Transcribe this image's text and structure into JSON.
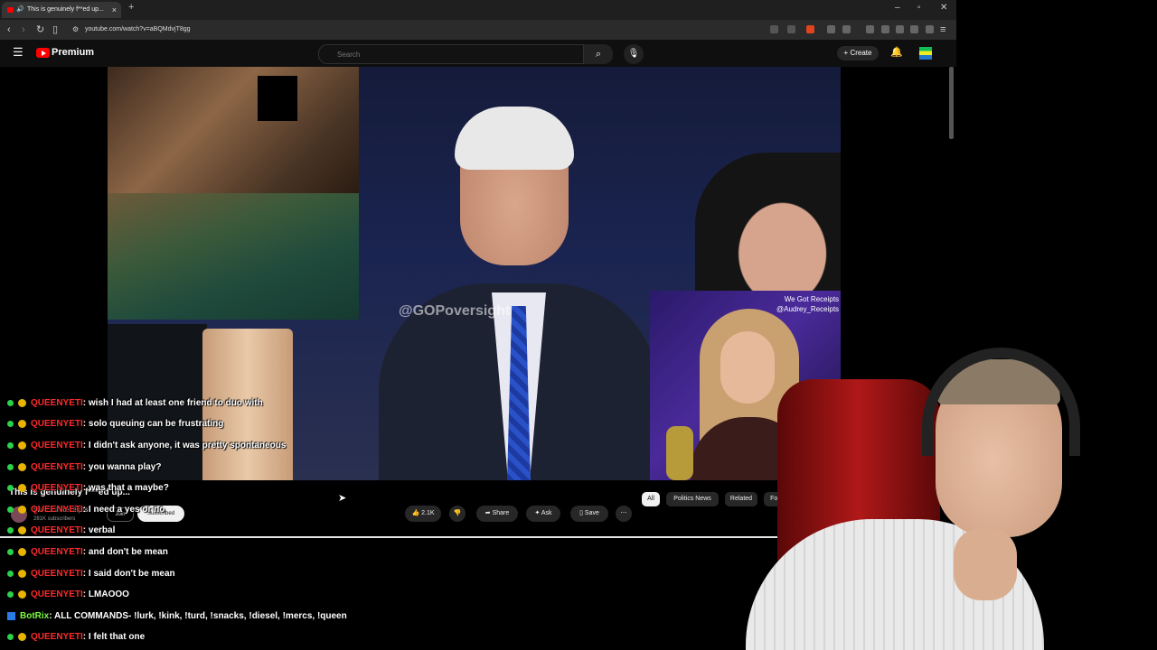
{
  "browser": {
    "tab_title": "This is genuinely f**ed up...",
    "new_tab": "+",
    "url": "youtube.com/watch?v=aBQMdvjT8gg"
  },
  "youtube": {
    "brand": "Premium",
    "search_placeholder": "Search",
    "create_label": "Create"
  },
  "video": {
    "watermark": "@GOPoversight",
    "pip_caption_line1": "We Got Receipts",
    "pip_caption_line2": "@Audrey_Receipts",
    "title": "This is genuinely f***ed up...",
    "channel_name": "We Got Receipts",
    "subscribers": "281K subscribers",
    "join_label": "Join",
    "subscribe_label": "Subscribed",
    "likes": "2.1K",
    "share_label": "Share",
    "ask_label": "Ask",
    "save_label": "Save"
  },
  "chips": [
    "All",
    "Politics News",
    "Related",
    "For you"
  ],
  "chat": [
    {
      "user": "QUEENYETI",
      "msg": ": wish I had at least one friend to duo with",
      "badge": "queen"
    },
    {
      "user": "QUEENYETI",
      "msg": ": solo queuing can be frustrating",
      "badge": "queen"
    },
    {
      "user": "QUEENYETI",
      "msg": ": I didn't ask anyone, it was pretty spontaneous",
      "badge": "queen"
    },
    {
      "user": "QUEENYETI",
      "msg": ": you wanna play?",
      "badge": "queen"
    },
    {
      "user": "QUEENYETI",
      "msg": ": was that a maybe?",
      "badge": "queen"
    },
    {
      "user": "QUEENYETI",
      "msg": ": I need a yes or no",
      "badge": "queen"
    },
    {
      "user": "QUEENYETI",
      "msg": ": verbal",
      "badge": "queen"
    },
    {
      "user": "QUEENYETI",
      "msg": ": and don't be mean",
      "badge": "queen"
    },
    {
      "user": "QUEENYETI",
      "msg": ": I said don't be mean",
      "badge": "queen"
    },
    {
      "user": "QUEENYETI",
      "msg": ": LMAOOO",
      "badge": "queen"
    },
    {
      "user": "BotRix",
      "msg": ": ALL COMMANDS- !lurk, !kink, !turd, !snacks, !diesel, !mercs, !queen",
      "badge": "bot"
    },
    {
      "user": "QUEENYETI",
      "msg": ": I felt that one",
      "badge": "queen"
    }
  ],
  "colors": {
    "queen": "#ff2a2a",
    "bot": "#7dfc40",
    "youtube_red": "#ff0000"
  }
}
